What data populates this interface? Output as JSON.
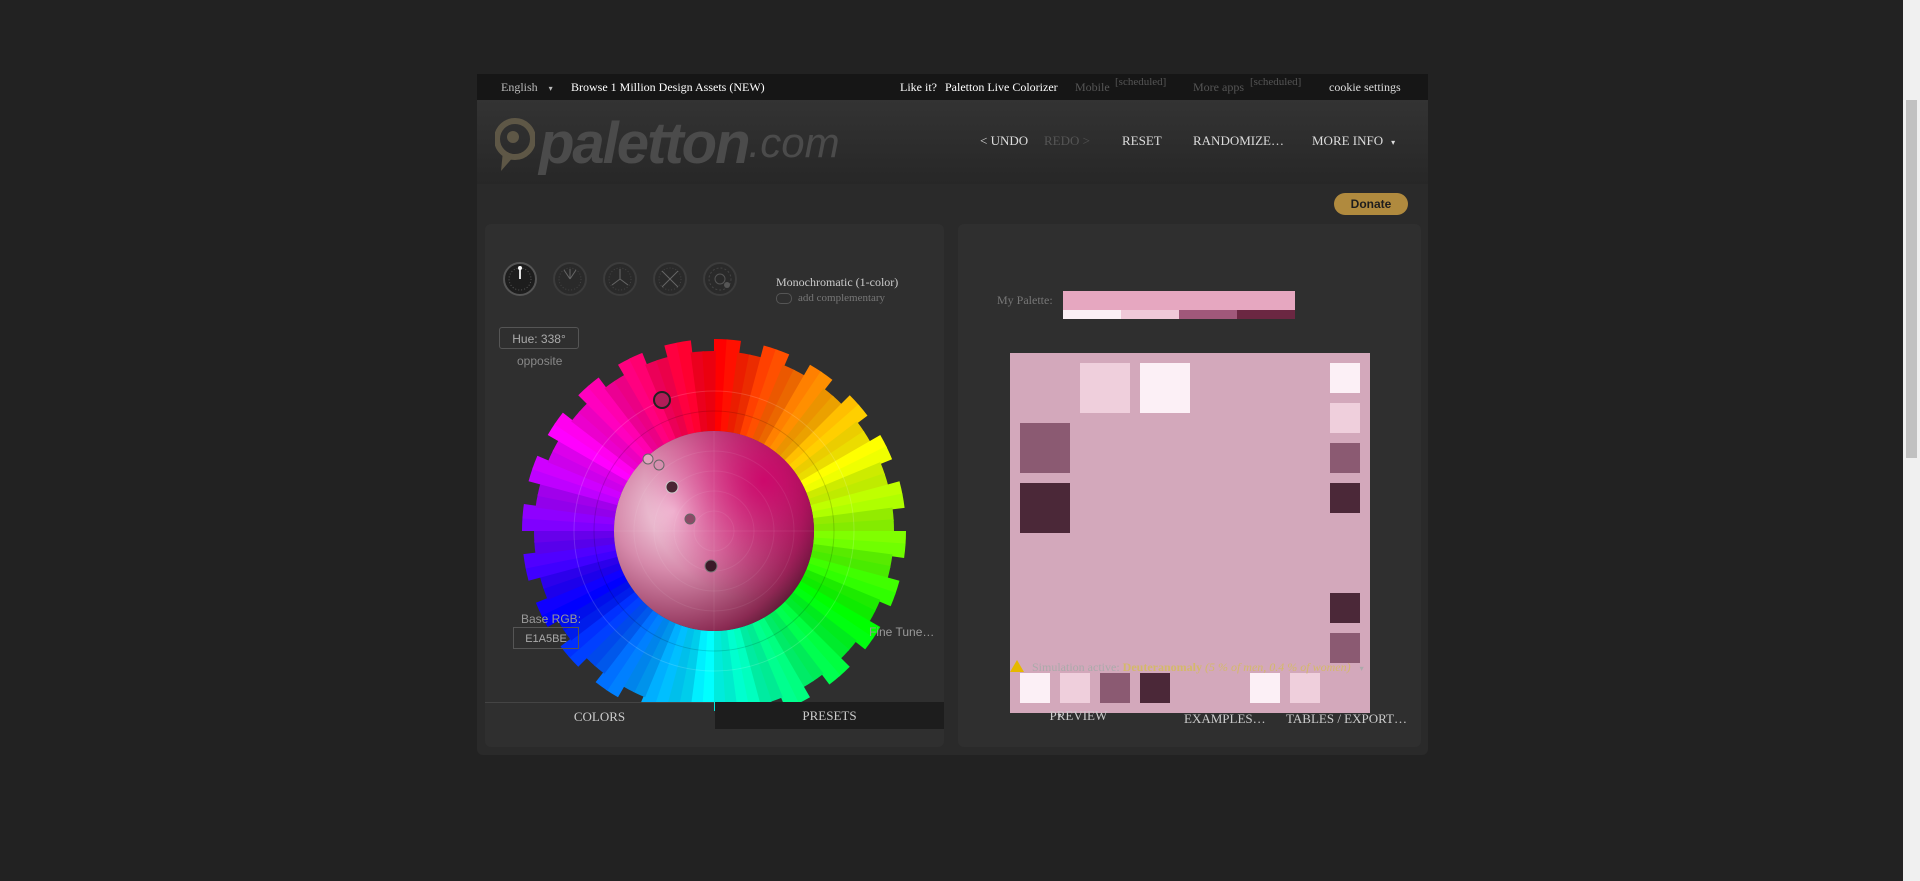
{
  "topbar": {
    "language": "English",
    "language_arrow": "▾",
    "browse": "Browse 1 Million Design Assets (NEW)",
    "likeit": "Like it?",
    "live_colorizer": "Paletton Live Colorizer",
    "mobile": "Mobile",
    "mobile_tag": "[scheduled]",
    "more_apps": "More apps",
    "more_apps_tag": "[scheduled]",
    "cookie": "cookie settings"
  },
  "header": {
    "logo_word": "paletton",
    "logo_dotcom": ".com",
    "undo": "< UNDO",
    "redo": "REDO >",
    "reset": "RESET",
    "randomize": "RANDOMIZE…",
    "more_info": "MORE INFO",
    "more_info_arrow": "▾"
  },
  "donate": "Donate",
  "left": {
    "scheme_label": "Monochromatic (1-color)",
    "add_complementary": "add complementary",
    "hue": "Hue: 338°",
    "opposite": "opposite",
    "base_rgb_label": "Base RGB:",
    "base_rgb_value": "E1A5BE",
    "fine_tune": "Fine Tune…",
    "tabs": {
      "colors": "COLORS",
      "presets": "PRESETS"
    },
    "scheme_icons": [
      "mono-scheme-icon",
      "adjacent-scheme-icon",
      "triad-scheme-icon",
      "tetrad-scheme-icon",
      "free-style-scheme-icon"
    ]
  },
  "right": {
    "my_palette": "My Palette:",
    "palette_main": "#e6a7c0",
    "palette_segments": [
      "#fbf0f5",
      "#f0c8d8",
      "#a0587a",
      "#6b2742"
    ],
    "preview_bg": "#d3a8bb",
    "warning": {
      "prefix": "Simulation active:",
      "name": "Deuteranomaly",
      "detail": "(5 % of men, 0.4 % of women)",
      "arrow": "▾"
    },
    "tabs": {
      "preview": "PREVIEW",
      "preview_arrow": "▾",
      "examples": "EXAMPLES…",
      "tables": "TABLES / EXPORT…"
    },
    "swatch_colors": {
      "lightest": "#fcf0f6",
      "light": "#efcfdc",
      "medium": "#8b5a72",
      "dark": "#4b2838"
    }
  }
}
